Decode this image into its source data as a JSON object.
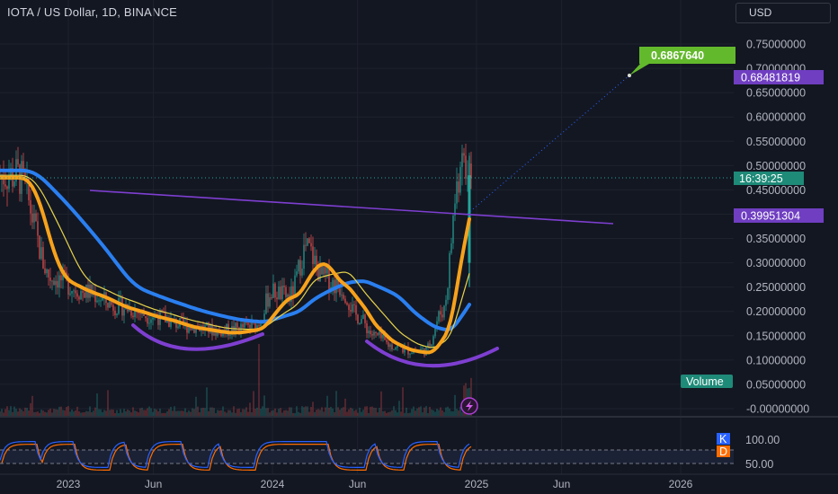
{
  "header": {
    "symbol_title": "IOTA / US Dollar, 1D, BINANCE",
    "currency": "USD"
  },
  "colors": {
    "background": "#131722",
    "price_up": "#26a69a",
    "price_down": "#ef5350",
    "ema_fast": "#f7a21b",
    "ema_slow": "#2a7ff0",
    "sma_yellow": "#e7d34a",
    "trendline": "#7e3fd1",
    "target": "#63b92c",
    "stoch_k": "#2962ff",
    "stoch_d": "#ff6d00"
  },
  "price_axis": {
    "ticks": [
      "0.75000000",
      "0.70000000",
      "0.65000000",
      "0.60000000",
      "0.55000000",
      "0.50000000",
      "0.45000000",
      "0.40000000",
      "0.35000000",
      "0.30000000",
      "0.25000000",
      "0.20000000",
      "0.15000000",
      "0.10000000",
      "0.05000000",
      "-0.00000000"
    ],
    "current_price_tag": "0.68481819",
    "countdown_tag": "16:39:25",
    "trendline_price_tag": "0.39951304",
    "target_label": "0.6867640"
  },
  "volume_label": "Volume",
  "stoch_axis": {
    "ticks": [
      "100.00",
      "50.00"
    ],
    "k_label": "K",
    "d_label": "D"
  },
  "time_axis": {
    "labels": [
      "2023",
      "Jun",
      "2024",
      "Jun",
      "2025",
      "Jun",
      "2026"
    ]
  },
  "chart_data": {
    "type": "line",
    "title": "IOTA / US Dollar, 1D, BINANCE",
    "xlabel": "",
    "ylabel": "",
    "ylim": [
      -0.01,
      0.78
    ],
    "grid": true,
    "x_ticks": [
      "2023",
      "Jun",
      "2024",
      "Jun",
      "2025",
      "Jun",
      "2026"
    ],
    "series": [
      {
        "x": [
          "2022-10",
          "2022-12",
          "2023-02",
          "2023-04",
          "2023-06",
          "2023-08",
          "2023-10",
          "2023-12",
          "2024-01",
          "2024-02",
          "2024-03",
          "2024-04",
          "2024-05",
          "2024-06",
          "2024-07",
          "2024-08",
          "2024-09",
          "2024-10",
          "2024-11",
          "2024-12"
        ],
        "values": [
          0.48,
          0.27,
          0.24,
          0.21,
          0.19,
          0.17,
          0.16,
          0.17,
          0.24,
          0.23,
          0.33,
          0.27,
          0.25,
          0.19,
          0.15,
          0.13,
          0.12,
          0.12,
          0.2,
          0.48
        ]
      }
    ],
    "trendline": {
      "start": [
        "2022-12",
        0.46
      ],
      "end": [
        "2025-08",
        0.39
      ]
    },
    "annotations": [
      "0.6867640",
      "0.68481819",
      "0.39951304",
      "16:39:25"
    ]
  }
}
